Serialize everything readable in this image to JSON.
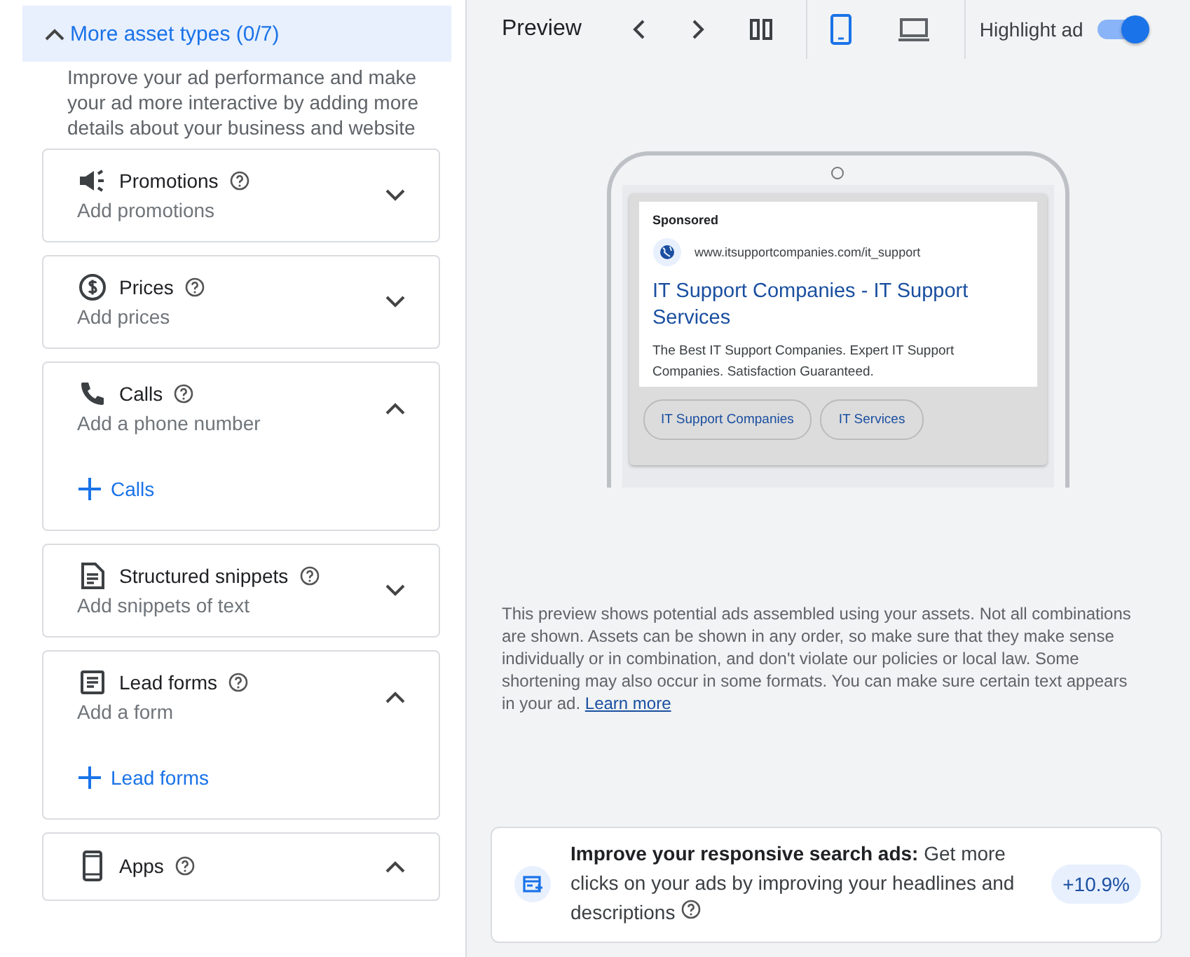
{
  "left_panel": {
    "section": {
      "title": "More asset types (0/7)",
      "expanded": true,
      "description": "Improve your ad performance and make your ad more interactive by adding more details about your business and website"
    },
    "assets": [
      {
        "kind": "promotions",
        "title": "Promotions",
        "subtitle": "Add promotions",
        "expanded": false
      },
      {
        "kind": "prices",
        "title": "Prices",
        "subtitle": "Add prices",
        "expanded": false
      },
      {
        "kind": "calls",
        "title": "Calls",
        "subtitle": "Add a phone number",
        "expanded": true,
        "add_label": "Calls"
      },
      {
        "kind": "snippets",
        "title": "Structured snippets",
        "subtitle": "Add snippets of text",
        "expanded": false
      },
      {
        "kind": "forms",
        "title": "Lead forms",
        "subtitle": "Add a form",
        "expanded": true,
        "add_label": "Lead forms"
      },
      {
        "kind": "apps",
        "title": "Apps",
        "expanded": true
      }
    ]
  },
  "preview": {
    "title": "Preview",
    "devices": [
      {
        "kind": "mobile",
        "selected": true
      },
      {
        "kind": "desktop",
        "selected": false
      }
    ],
    "highlight": {
      "label": "Highlight ad",
      "on": true
    },
    "ad": {
      "sponsored": "Sponsored",
      "url": "www.itsupportcompanies.com/it_support",
      "headline": "IT Support Companies - IT Support Services",
      "description": "The Best IT Support Companies. Expert IT Support Companies. Satisfaction Guaranteed.",
      "sitelinks": [
        "IT Support Companies",
        "IT Services"
      ]
    },
    "disclaimer": "This preview shows potential ads assembled using your assets. Not all combinations are shown. Assets can be shown in any order, so make sure that they make sense individually or in combination, and don't violate our policies or local law. Some shortening may also occur in some formats. You can make sure certain text appears in your ad.",
    "learn_more": "Learn more"
  },
  "suggestion": {
    "text": "**Improve your responsive search ads:** Get more clicks on your ads by improving your headlines and descriptions",
    "badge": "+10.9%"
  }
}
